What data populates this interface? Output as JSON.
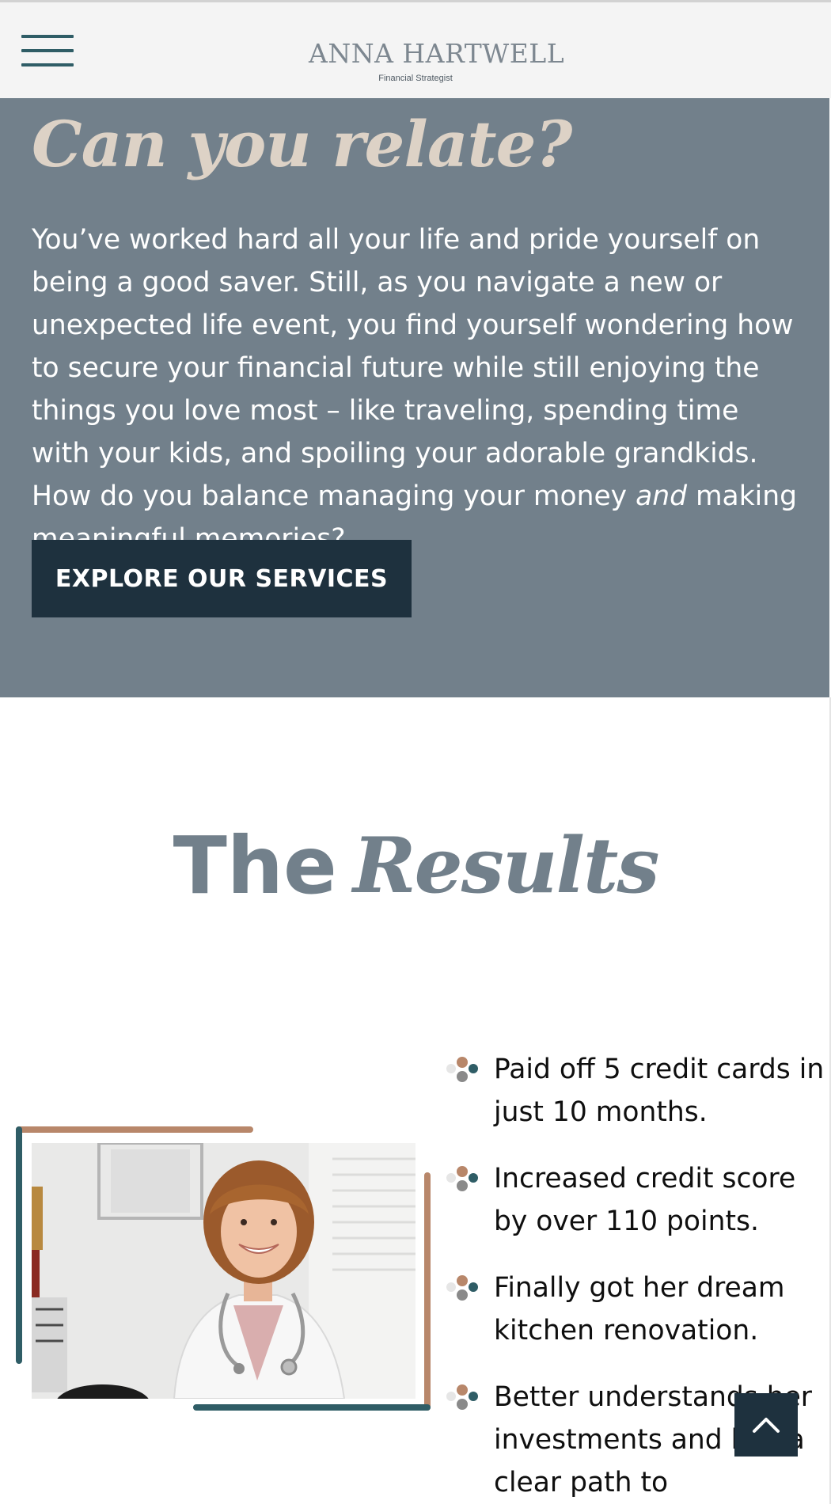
{
  "header": {
    "menu_icon": "hamburger-menu-icon",
    "logo_name": "ANNA HARTWELL",
    "logo_tagline": "Financial Strategist"
  },
  "relate": {
    "title": "Can you relate?",
    "text_before": "You’ve worked hard all your life and pride yourself on being a good saver. Still, as you navigate a new or unexpected life event, you find yourself wondering how to secure your financial future while still enjoying the things you love most – like traveling, spending time with your kids, and spoiling your adorable grandkids. How do you balance managing your money ",
    "text_emphasis": "and",
    "text_after": " making meaningful memories?",
    "button_label": "EXPLORE OUR SERVICES"
  },
  "results": {
    "heading_plain": "The",
    "heading_script": "Results",
    "items": [
      {
        "text": "Paid off 5 credit cards in just 10 months."
      },
      {
        "text": "Increased credit score by over 110 points."
      },
      {
        "text": "Finally got her dream kitchen renovation."
      },
      {
        "text": "Better understands her investments and has a clear path to retirement."
      }
    ]
  },
  "back_to_top_icon": "chevron-up-icon",
  "colors": {
    "slate": "#72808b",
    "navy": "#1e313e",
    "teal": "#2f5d66",
    "copper": "#b8876a",
    "sand": "#ddd2c6"
  }
}
